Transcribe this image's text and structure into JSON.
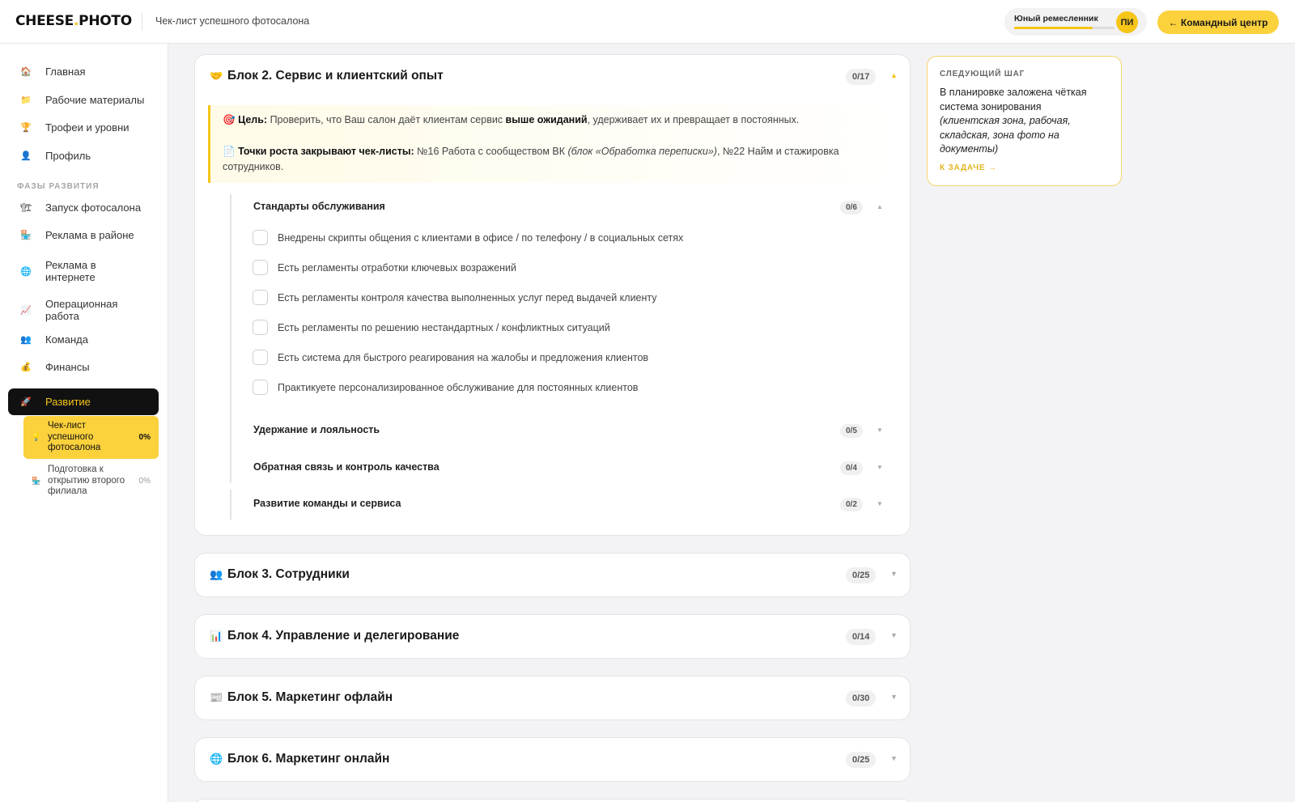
{
  "header": {
    "logo_main": "CHEESE",
    "logo_dot": ".",
    "logo_rest": "PHOTO",
    "title": "Чек-лист успешного фотосалона",
    "rank_label": "Юный ремесленник",
    "rank_progress_percent": 78,
    "avatar_initials": "ПИ",
    "command_center_label": "← Командный центр"
  },
  "sidebar": {
    "main_items": [
      {
        "icon": "🏠",
        "label": "Главная"
      },
      {
        "icon": "📁",
        "label": "Рабочие материалы"
      },
      {
        "icon": "🏆",
        "label": "Трофеи и уровни"
      },
      {
        "icon": "👤",
        "label": "Профиль"
      }
    ],
    "section_title": "ФАЗЫ РАЗВИТИЯ",
    "phase_items": [
      {
        "icon": "🏗",
        "label": "Запуск фотосалона"
      },
      {
        "icon": "🏪",
        "label": "Реклама в районе"
      },
      {
        "icon": "🌐",
        "label": "Реклама в интернете"
      },
      {
        "icon": "📈",
        "label": "Операционная работа"
      },
      {
        "icon": "👥",
        "label": "Команда"
      },
      {
        "icon": "💰",
        "label": "Финансы"
      },
      {
        "icon": "🚀",
        "label": "Развитие"
      }
    ],
    "sub_items": [
      {
        "icon": "💡",
        "label": "Чек-лист успешного фотосалона",
        "percent": "0%"
      },
      {
        "icon": "🏪",
        "label": "Подготовка к открытию второго филиала",
        "percent": "0%"
      }
    ]
  },
  "blocks": {
    "block2": {
      "emoji": "🤝",
      "title": "Блок 2. Сервис и клиентский опыт",
      "count": "0/17",
      "goal_emoji": "🎯",
      "goal_label": "Цель:",
      "goal_text_1": " Проверить, что Ваш салон даёт клиентам сервис ",
      "goal_bold": "выше ожиданий",
      "goal_text_2": ", удерживает их и превращает в постоянных.",
      "growth_emoji": "📄",
      "growth_label": "Точки роста закрывают чек-листы:",
      "growth_text_1": " №16 Работа с сообществом ВК ",
      "growth_italic": "(блок «Обработка переписки»)",
      "growth_text_2": ", №22 Найм и стажировка",
      "growth_text_3": "сотрудников.",
      "groups": [
        {
          "title": "Стандарты обслуживания",
          "count": "0/6",
          "items": [
            "Внедрены скрипты общения с клиентами в офисе / по телефону / в социальных сетях",
            "Есть регламенты отработки ключевых возражений",
            "Есть регламенты контроля качества выполненных услуг перед выдачей клиенту",
            "Есть регламенты по решению нестандартных / конфликтных ситуаций",
            "Есть система для быстрого реагирования на жалобы и предложения клиентов",
            "Практикуете персонализированное обслуживание для постоянных клиентов"
          ]
        },
        {
          "title": "Удержание и лояльность",
          "count": "0/5"
        },
        {
          "title": "Обратная связь и контроль качества",
          "count": "0/4"
        },
        {
          "title": "Развитие команды и сервиса",
          "count": "0/2"
        }
      ]
    },
    "block3": {
      "emoji": "👥",
      "title": "Блок 3. Сотрудники",
      "count": "0/25"
    },
    "block4": {
      "emoji": "📊",
      "title": "Блок 4. Управление и делегирование",
      "count": "0/14"
    },
    "block5": {
      "emoji": "📰",
      "title": "Блок 5. Маркетинг офлайн",
      "count": "0/30"
    },
    "block6": {
      "emoji": "🌐",
      "title": "Блок 6. Маркетинг онлайн",
      "count": "0/25"
    }
  },
  "next_step": {
    "label": "СЛЕДУЮЩИЙ ШАГ",
    "text": "В планировке заложена чёткая система зонирования",
    "italic": "(клиентская зона, рабочая, складская, зона фото на документы)",
    "link": "К ЗАДАЧЕ →"
  },
  "colors": {
    "accent": "#f5c518",
    "accent_button": "#fbd13c",
    "active_nav": "#111111"
  }
}
